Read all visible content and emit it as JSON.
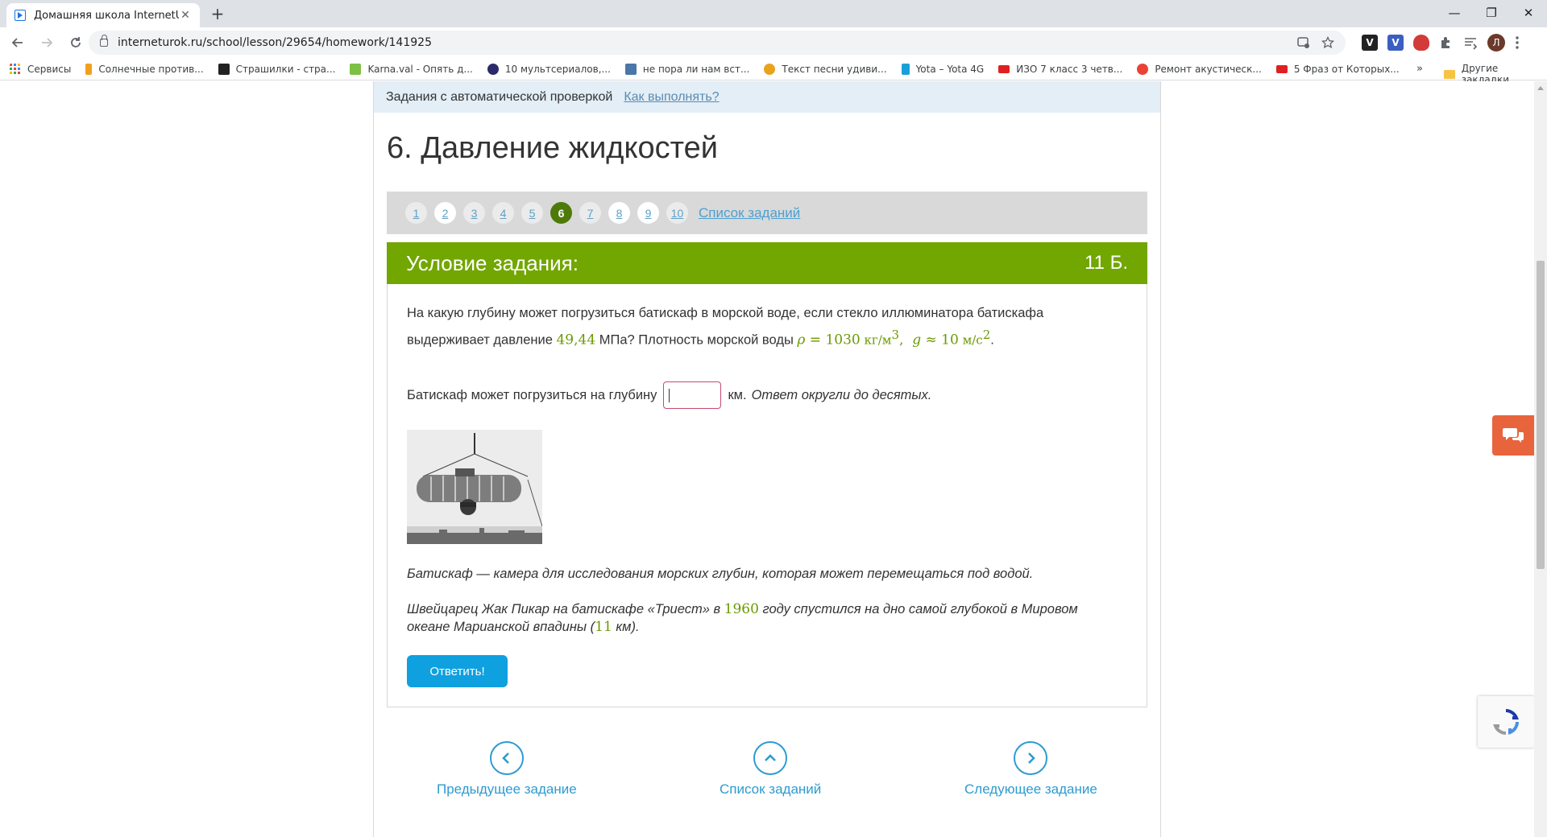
{
  "browser": {
    "tab_title": "Домашняя школа InternetUrok.r",
    "tab_close": "✕",
    "new_tab": "+",
    "url": "interneturok.ru/school/lesson/29654/homework/141925",
    "window_controls": {
      "minimize": "—",
      "maximize": "❐",
      "close": "✕"
    },
    "avatar_letter": "Л",
    "extensions": [
      {
        "icon": "v-dark-ext-icon",
        "label": "V",
        "color": "#222222"
      },
      {
        "icon": "v-blue-ext-icon",
        "label": "V",
        "color": "#3b5fc0"
      },
      {
        "icon": "shield-ext-icon",
        "label": "",
        "color": "#d33a3a"
      }
    ]
  },
  "bookmarks": {
    "items": [
      {
        "label": "Сервисы",
        "color": "#4285f4"
      },
      {
        "label": "Солнечные против...",
        "color": "#f0a020"
      },
      {
        "label": "Страшилки - стра...",
        "color": "#222222"
      },
      {
        "label": "Karna.val - Опять д...",
        "color": "#7cc144"
      },
      {
        "label": "10 мультсериалов,...",
        "color": "#2b2b6b"
      },
      {
        "label": "не пора ли нам вст...",
        "color": "#4a76a8"
      },
      {
        "label": "Текст песни удиви...",
        "color": "#e8a31c"
      },
      {
        "label": "Yota – Yota 4G",
        "color": "#1aa0d8"
      },
      {
        "label": "ИЗО 7 класс 3 четв...",
        "color": "#e02020"
      },
      {
        "label": "Ремонт акустическ...",
        "color": "#ea4335"
      },
      {
        "label": "5 Фраз от Которых...",
        "color": "#e02020"
      }
    ],
    "more": "»",
    "other": "Другие закладки"
  },
  "page": {
    "auto_check_text": "Задания с автоматической проверкой",
    "how_to_link": "Как выполнять?",
    "title": "6. Давление жидкостей",
    "pager": {
      "numbers": [
        "1",
        "2",
        "3",
        "4",
        "5",
        "6",
        "7",
        "8",
        "9",
        "10"
      ],
      "active": "6",
      "task_list_link": "Список заданий"
    },
    "task": {
      "header": "Условие задания:",
      "score": "11 Б.",
      "text_part1": "На какую глубину может погрузиться батискаф в морской воде, если стекло иллюминатора батискафа выдерживает давление ",
      "pressure_value": "49,44",
      "text_part2": " МПа? Плотность морской воды ",
      "rho_symbol": "ρ",
      "rho_value": " = 1030",
      "rho_unit": " кг/м",
      "rho_exp": "3",
      "g_symbol": "g",
      "g_value": " ≈ 10",
      "g_unit": " м/с",
      "g_exp": "2",
      "answer_label": "Батискаф может погрузиться на глубину",
      "answer_unit": "км.",
      "answer_hint": "Ответ округли до десятых.",
      "note1": "Батискаф — камера для исследования морских глубин, которая может перемещаться под водой.",
      "note2_part1": "Швейцарец Жак Пикар на батискафе «Триест» в ",
      "year": "1960",
      "note2_part2": " году спустился на дно самой глубокой в Мировом океане Марианской впадины (",
      "depth": "11",
      "note2_part3": " км).",
      "submit_label": "Ответить!"
    },
    "bottom_nav": {
      "prev": "Предыдущее задание",
      "list": "Список заданий",
      "next": "Следующее задание"
    }
  }
}
